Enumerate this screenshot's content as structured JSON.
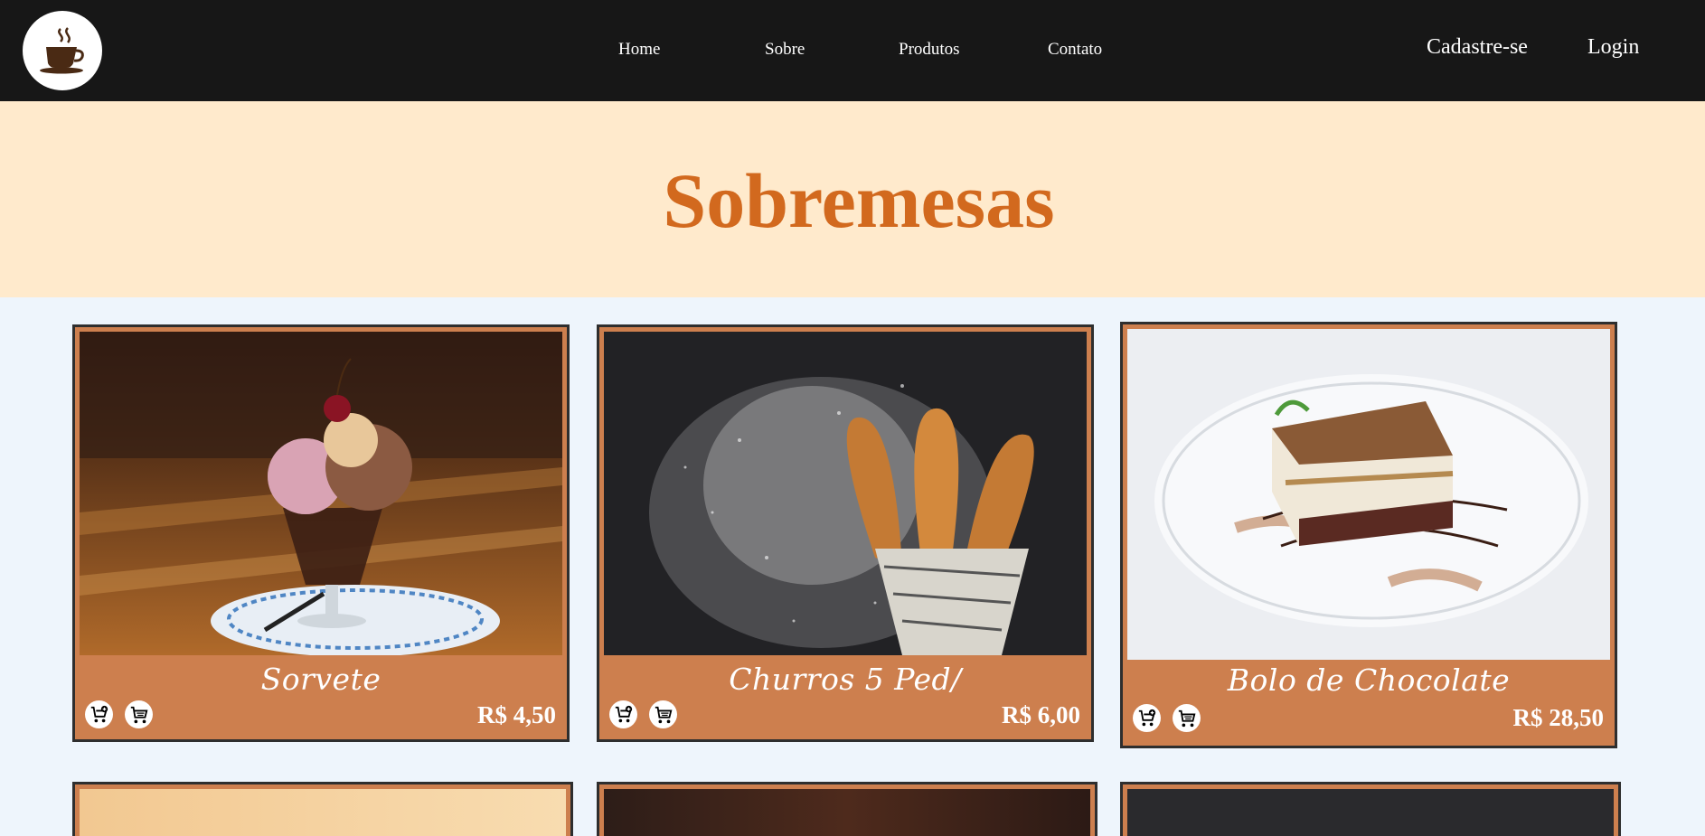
{
  "nav": {
    "logo": "coffee-cup-logo",
    "links": [
      "Home",
      "Sobre",
      "Produtos",
      "Contato"
    ],
    "signup": "Cadastre-se",
    "login": "Login"
  },
  "banner": {
    "title": "Sobremesas"
  },
  "products": [
    {
      "name": "Sorvete",
      "price": "R$ 4,50"
    },
    {
      "name": "Churros 5 Ped/",
      "price": "R$ 6,00"
    },
    {
      "name": "Bolo de Chocolate",
      "price": "R$ 28,50"
    }
  ],
  "icons": {
    "add_to_cart": "cart-plus-icon",
    "cart": "cart-icon"
  },
  "colors": {
    "navbar": "#171717",
    "banner": "#ffeacc",
    "title": "#d2691e",
    "card": "#cd7f4e",
    "page": "#eef5fc"
  }
}
